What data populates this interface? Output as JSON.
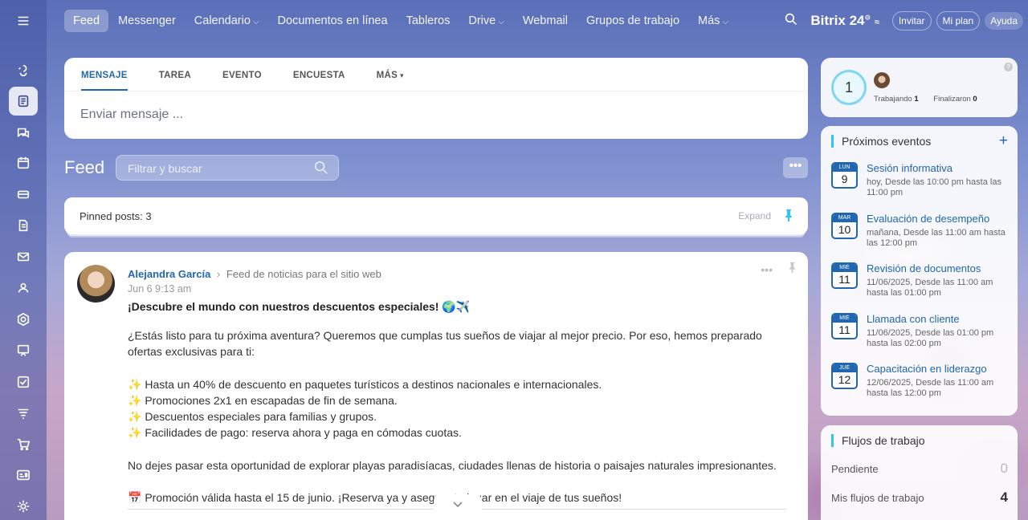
{
  "topbar": {
    "nav": [
      {
        "label": "Feed",
        "active": true,
        "dropdown": false
      },
      {
        "label": "Messenger",
        "active": false,
        "dropdown": false
      },
      {
        "label": "Calendario",
        "active": false,
        "dropdown": true
      },
      {
        "label": "Documentos en línea",
        "active": false,
        "dropdown": false
      },
      {
        "label": "Tableros",
        "active": false,
        "dropdown": false
      },
      {
        "label": "Drive",
        "active": false,
        "dropdown": true
      },
      {
        "label": "Webmail",
        "active": false,
        "dropdown": false
      },
      {
        "label": "Grupos de trabajo",
        "active": false,
        "dropdown": false
      },
      {
        "label": "Más",
        "active": false,
        "dropdown": true
      }
    ],
    "brand": "Bitrix 24",
    "invite": "Invitar",
    "plan": "Mi plan",
    "help": "Ayuda"
  },
  "composer": {
    "tabs": [
      "MENSAJE",
      "TAREA",
      "EVENTO",
      "ENCUESTA",
      "MÁS"
    ],
    "placeholder": "Enviar mensaje ..."
  },
  "feed": {
    "title": "Feed",
    "search_placeholder": "Filtrar y buscar",
    "pinned_label": "Pinned posts: 3",
    "expand": "Expand"
  },
  "post": {
    "author": "Alejandra García",
    "destination": "Feed de noticias para el sitio web",
    "date": "Jun 6 9:13 am",
    "title": "¡Descubre el mundo con nuestros descuentos especiales! 🌍✈️",
    "intro": "¿Estás listo para tu próxima aventura? Queremos que cumplas tus sueños de viajar al mejor precio. Por eso, hemos preparado ofertas exclusivas para ti:",
    "bullets": [
      "Hasta un 40% de descuento en paquetes turísticos a destinos nacionales e internacionales.",
      "Promociones 2x1 en escapadas de fin de semana.",
      "Descuentos especiales para familias y grupos.",
      "Facilidades de pago: reserva ahora y paga en cómodas cuotas."
    ],
    "paragraph": "No dejes pasar esta oportunidad de explorar playas paradisíacas, ciudades llenas de historia o paisajes naturales impresionantes.",
    "promo": "Promoción válida hasta el 15 de junio. ¡Reserva ya y asegura tu lugar en el viaje de tus sueños!"
  },
  "status_widget": {
    "count": "1",
    "working_label": "Trabajando",
    "working": "1",
    "finished_label": "Finalizaron",
    "finished": "0"
  },
  "events_widget": {
    "title": "Próximos eventos",
    "events": [
      {
        "dow": "LUN",
        "day": "9",
        "title": "Sesión informativa",
        "desc": "hoy, Desde las 10:00 pm hasta las 11:00 pm"
      },
      {
        "dow": "MAR",
        "day": "10",
        "title": "Evaluación de desempeño",
        "desc": "mañana, Desde las 11:00 am hasta las 12:00 pm"
      },
      {
        "dow": "MIÉ",
        "day": "11",
        "title": "Revisión de documentos",
        "desc": "11/06/2025, Desde las 11:00 am hasta las 01:00 pm"
      },
      {
        "dow": "MIÉ",
        "day": "11",
        "title": "Llamada con cliente",
        "desc": "11/06/2025, Desde las 01:00 pm hasta las 02:00 pm"
      },
      {
        "dow": "JUE",
        "day": "12",
        "title": "Capacitación en liderazgo",
        "desc": "12/06/2025, Desde las 11:00 am hasta las 12:00 pm"
      }
    ]
  },
  "flows_widget": {
    "title": "Flujos de trabajo",
    "pending_label": "Pendiente",
    "pending": "0",
    "mine_label": "Mis flujos de trabajo",
    "mine": "4"
  },
  "sidebar_icons": [
    "menu-icon",
    "collab-icon",
    "feed-icon",
    "chat-icon",
    "calendar-icon",
    "drive-icon",
    "document-icon",
    "mail-icon",
    "groups-icon",
    "sites-icon",
    "presentation-icon",
    "tasks-icon",
    "filter-icon",
    "cart-icon",
    "contact-card-icon",
    "settings-icon"
  ]
}
